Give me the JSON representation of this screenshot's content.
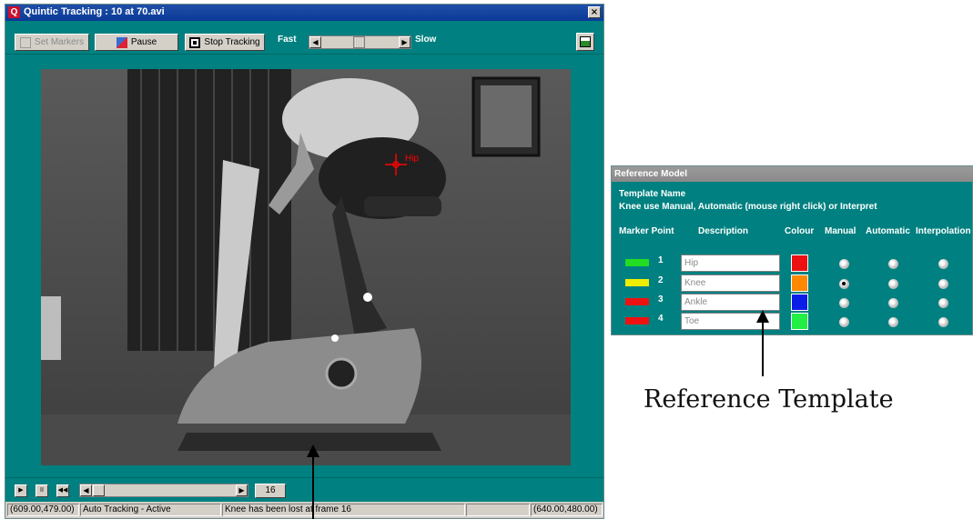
{
  "window": {
    "title": "Quintic Tracking : 10 at 70.avi",
    "logo_letter": "Q",
    "close_glyph": "×"
  },
  "toolbar": {
    "set_markers": "Set Markers",
    "pause": "Pause",
    "stop_tracking": "Stop Tracking",
    "fast": "Fast",
    "slow": "Slow"
  },
  "video": {
    "marker_label": "Hip"
  },
  "transport": {
    "frame": "16"
  },
  "status": {
    "coords_left": "(609.00,479.00)",
    "mode": "Auto Tracking - Active",
    "message": "Knee  has been lost at frame 16",
    "coords_right": "(640.00,480.00)"
  },
  "reference": {
    "title": "Reference Model",
    "template_name_label": "Template Name",
    "instruction": "Knee  use Manual, Automatic (mouse right click) or Interpret",
    "headers": {
      "marker_point": "Marker Point",
      "description": "Description",
      "colour": "Colour",
      "manual": "Manual",
      "automatic": "Automatic",
      "interpolation": "Interpolation"
    },
    "rows": [
      {
        "num": "1",
        "description": "Hip",
        "swatch": "#22dd22",
        "colour": "#ee1111",
        "selected": "none"
      },
      {
        "num": "2",
        "description": "Knee",
        "swatch": "#eeee00",
        "colour": "#ff8800",
        "selected": "manual"
      },
      {
        "num": "3",
        "description": "Ankle",
        "swatch": "#ee1111",
        "colour": "#0a1ee8",
        "selected": "none"
      },
      {
        "num": "4",
        "description": "Toe",
        "swatch": "#ee1111",
        "colour": "#22ee44",
        "selected": "none"
      }
    ]
  },
  "annotations": {
    "reference_template": "Reference Template"
  },
  "colors": {
    "teal": "#008080",
    "titlebar": "#0a3a96",
    "tracking_marker": "#ff0000"
  }
}
